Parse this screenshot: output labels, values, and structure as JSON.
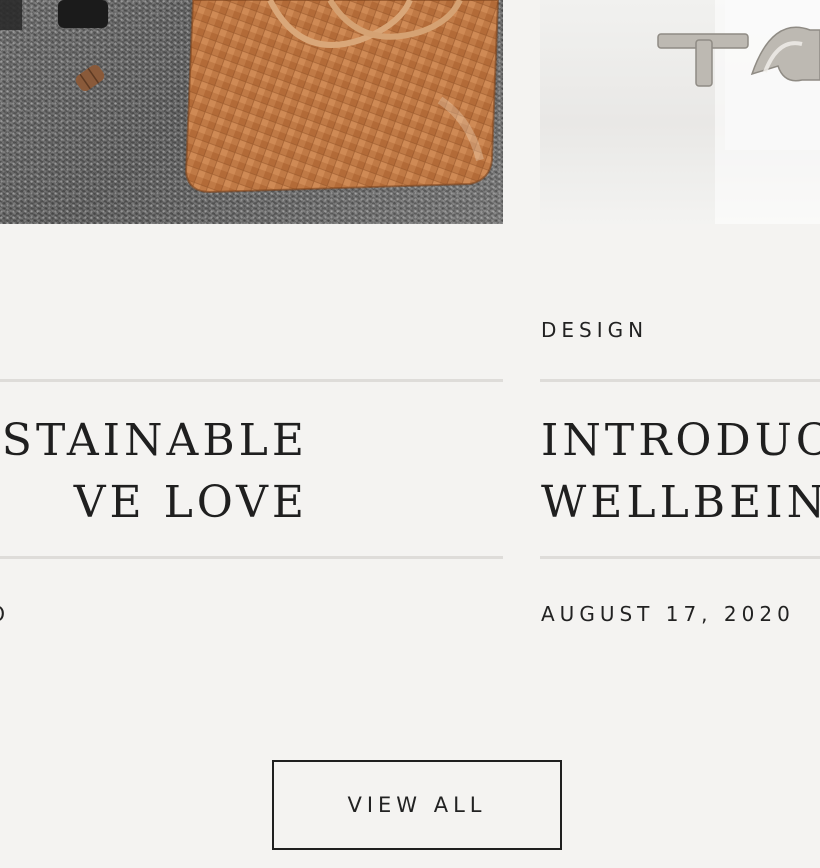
{
  "cards": [
    {
      "image_icon": "handbag-photo",
      "category": "",
      "title_lines": [
        "USTAINABLE",
        "VE LOVE"
      ],
      "date": "O"
    },
    {
      "image_icon": "metal-object-photo",
      "category": "DESIGN",
      "title_lines": [
        "INTRODUC",
        "WELLBEINC"
      ],
      "date": "AUGUST 17, 2020"
    }
  ],
  "view_all_label": "VIEW ALL",
  "colors": {
    "background": "#f4f3f1",
    "text": "#1f1f1f",
    "divider": "#dedcd9",
    "bag_leather": "#c27a45"
  }
}
